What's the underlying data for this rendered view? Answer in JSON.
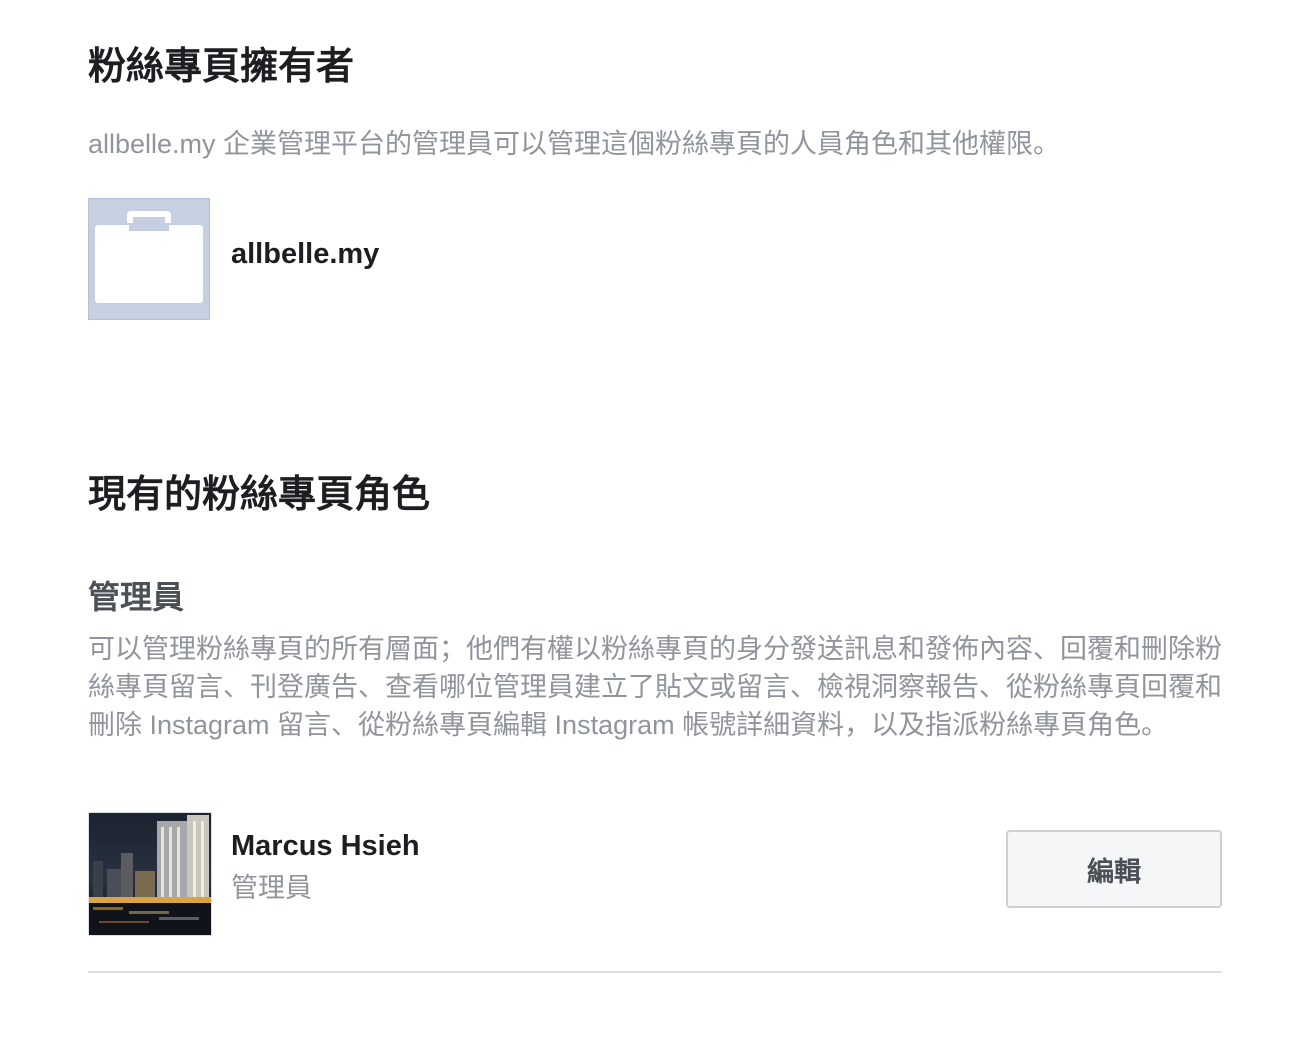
{
  "owner_section": {
    "title": "粉絲專頁擁有者",
    "description": "allbelle.my 企業管理平台的管理員可以管理這個粉絲專頁的人員角色和其他權限。",
    "business": {
      "name": "allbelle.my",
      "avatar_icon": "briefcase-icon"
    }
  },
  "roles_section": {
    "title": "現有的粉絲專頁角色",
    "admin": {
      "heading": "管理員",
      "description": "可以管理粉絲專頁的所有層面；他們有權以粉絲專頁的身分發送訊息和發佈內容、回覆和刪除粉絲專頁留言、刊登廣告、查看哪位管理員建立了貼文或留言、檢視洞察報告、從粉絲專頁回覆和刪除 Instagram 留言、從粉絲專頁編輯 Instagram 帳號詳細資料，以及指派粉絲專頁角色。",
      "members": [
        {
          "name": "Marcus Hsieh",
          "role": "管理員",
          "edit_label": "編輯"
        }
      ]
    }
  },
  "colors": {
    "primary_text": "#1c1e21",
    "secondary_text": "#90949c",
    "heading_gray": "#4b4f56",
    "avatar_bg": "#c7cfe3",
    "button_bg": "#f5f6f7",
    "border": "#ccd0d5"
  }
}
